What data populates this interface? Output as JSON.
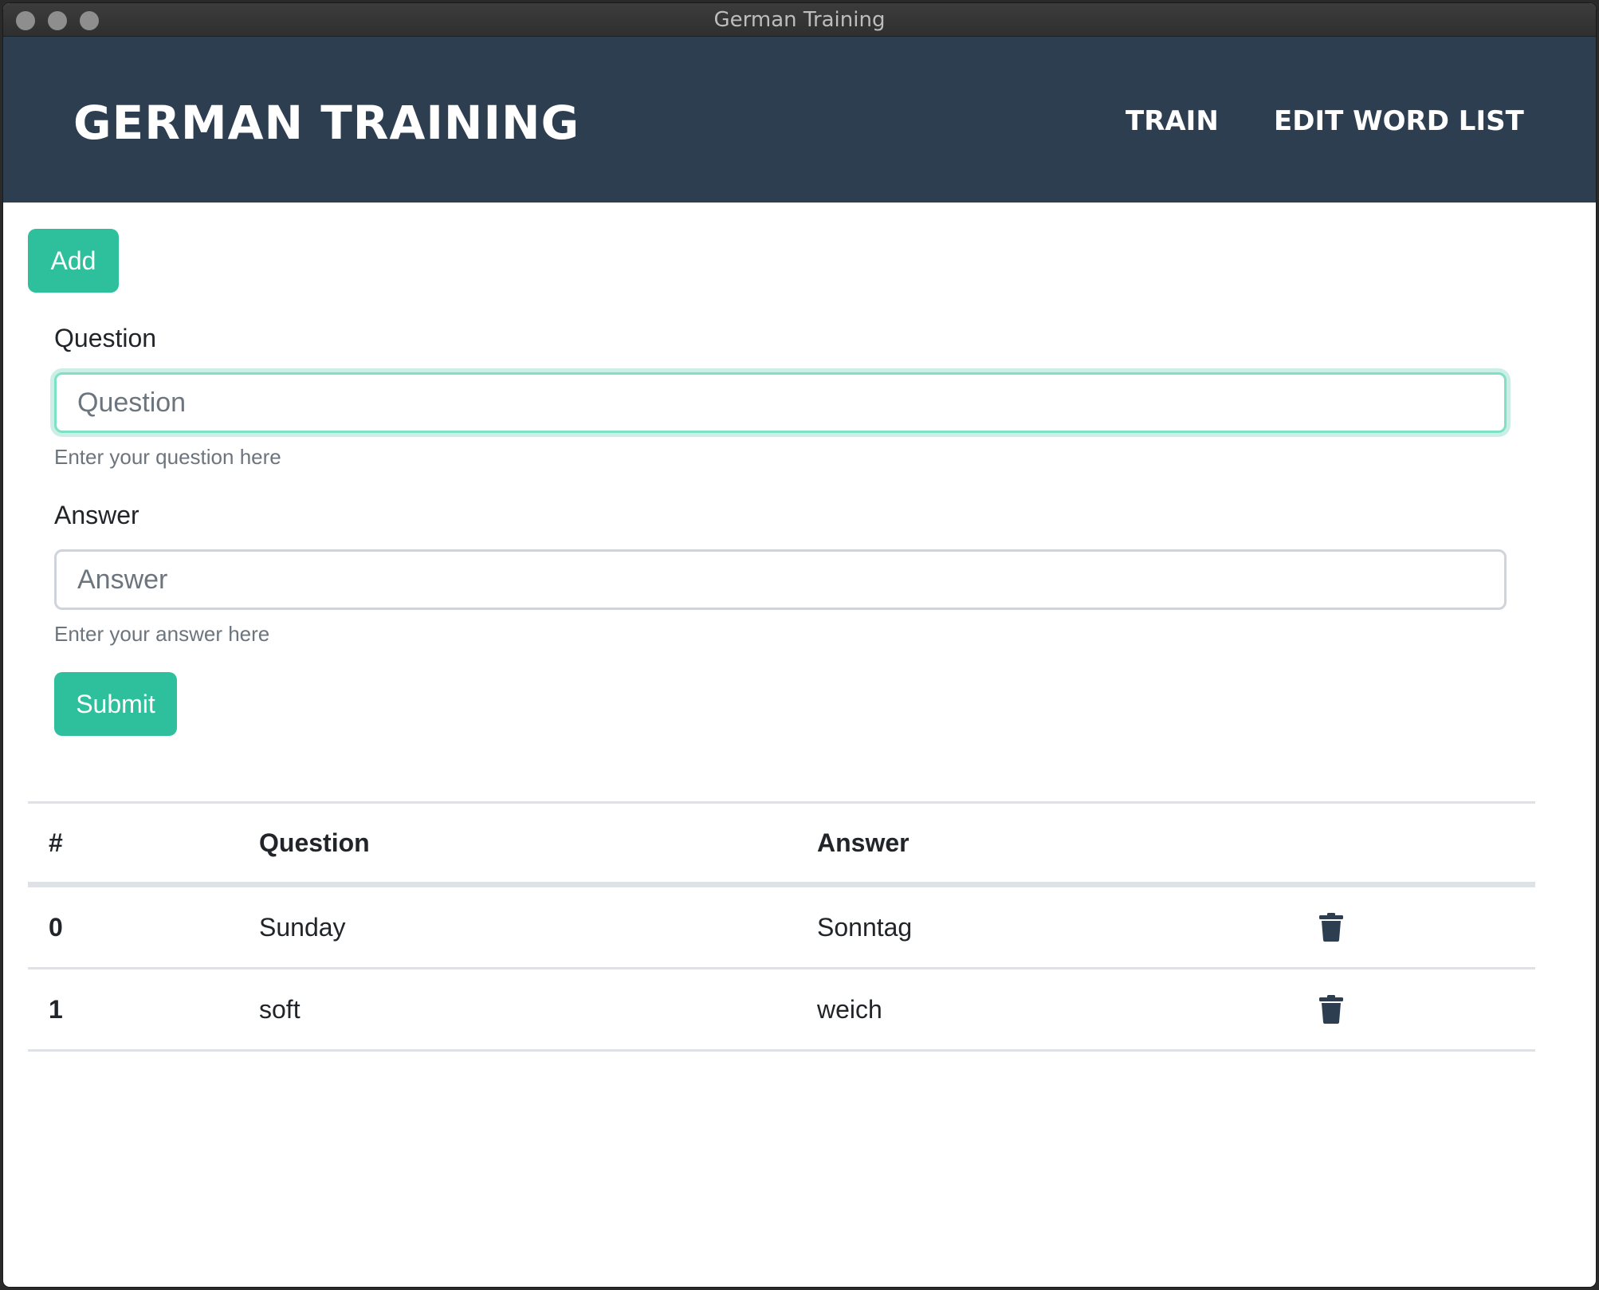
{
  "window": {
    "title": "German Training"
  },
  "navbar": {
    "brand": "GERMAN TRAINING",
    "links": [
      {
        "label": "TRAIN"
      },
      {
        "label": "EDIT WORD LIST"
      }
    ]
  },
  "form": {
    "add_label": "Add",
    "question": {
      "label": "Question",
      "placeholder": "Question",
      "value": "",
      "help": "Enter your question here"
    },
    "answer": {
      "label": "Answer",
      "placeholder": "Answer",
      "value": "",
      "help": "Enter your answer here"
    },
    "submit_label": "Submit"
  },
  "table": {
    "headers": [
      "#",
      "Question",
      "Answer"
    ],
    "rows": [
      {
        "index": "0",
        "question": "Sunday",
        "answer": "Sonntag",
        "action_icon": "trash-icon"
      },
      {
        "index": "1",
        "question": "soft",
        "answer": "weich",
        "action_icon": "trash-icon"
      }
    ]
  },
  "colors": {
    "navbar_bg": "#2e3e51",
    "accent": "#2ec09c",
    "text": "#212529",
    "muted": "#6c757d"
  }
}
